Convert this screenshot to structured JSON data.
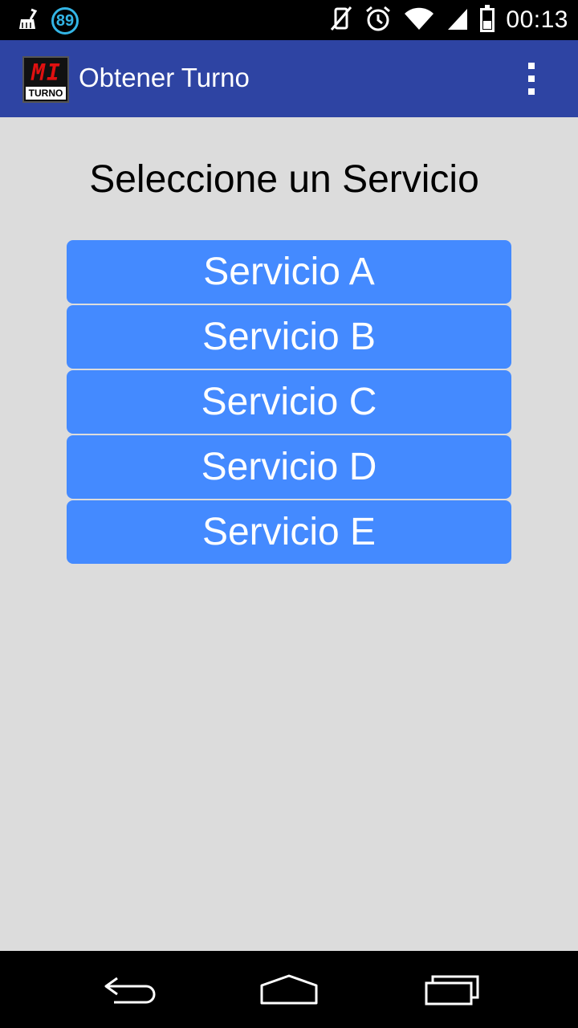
{
  "status_bar": {
    "notification_count": "89",
    "time": "00:13",
    "icons": [
      "cleaner-broom-icon",
      "notification-badge-icon",
      "vibrate-silent-icon",
      "alarm-clock-icon",
      "wifi-icon",
      "signal-icon",
      "battery-icon"
    ]
  },
  "action_bar": {
    "logo_digits": "MI",
    "logo_text": "TURNO",
    "title": "Obtener Turno",
    "overflow_icon": "overflow-menu-icon"
  },
  "main": {
    "heading": "Seleccione un Servicio",
    "services": [
      {
        "label": "Servicio A"
      },
      {
        "label": "Servicio B"
      },
      {
        "label": "Servicio C"
      },
      {
        "label": "Servicio D"
      },
      {
        "label": "Servicio E"
      }
    ]
  },
  "nav_bar": {
    "icons": [
      "back-icon",
      "home-icon",
      "recents-icon"
    ]
  },
  "colors": {
    "status_bar": "#000000",
    "action_bar": "#2e44a3",
    "content_bg": "#dcdcdc",
    "button": "#448aff",
    "badge": "#33b5e5"
  }
}
